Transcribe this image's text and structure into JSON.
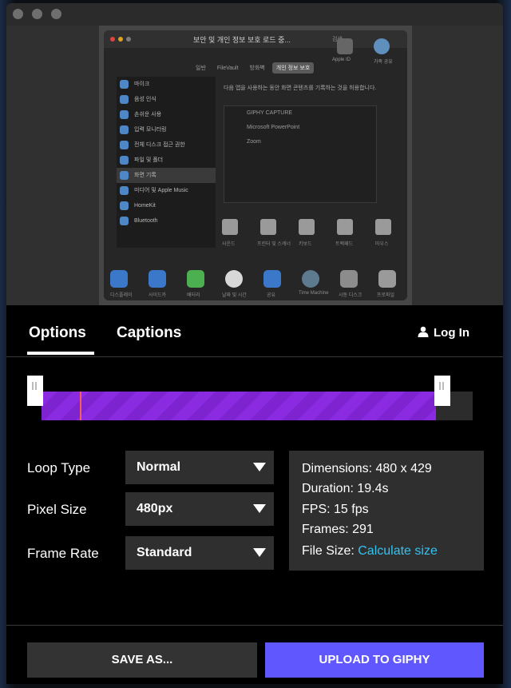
{
  "preview": {
    "window_title": "보안 및 개인 정보 보호 로드 중...",
    "search_placeholder": "검색",
    "tabs": [
      "일반",
      "FileVault",
      "방화벽",
      "개인 정보 보호"
    ],
    "active_tab": "개인 정보 보호",
    "list": [
      "마이크",
      "음성 인식",
      "손쉬운 사용",
      "입력 모니터링",
      "전체 디스크 접근 권한",
      "파일 및 폴더",
      "화면 기록",
      "미디어 및 Apple Music",
      "HomeKit",
      "Bluetooth"
    ],
    "selected_item": "화면 기록",
    "description": "다음 앱을 사용하는 동안 화면 콘텐츠를 기록하는 것을 허용합니다.",
    "apps": [
      "GIPHY CAPTURE",
      "Microsoft PowerPoint",
      "Zoom"
    ],
    "apple_id_label": "Apple ID",
    "family_label": "가족 공유",
    "bottom_icons": [
      "디스플레이",
      "사이드카",
      "배터리",
      "날짜 및 시간",
      "공유",
      "Time Machine",
      "시동 디스크",
      "프로파일"
    ],
    "grey_icons": [
      "사운드",
      "프린터 및 스캐너",
      "키보드",
      "트랙패드",
      "마우스"
    ]
  },
  "tabs": {
    "options": "Options",
    "captions": "Captions",
    "active": "Options"
  },
  "login": "Log In",
  "clip": {
    "start": 0.0,
    "end": 0.915,
    "playhead": 0.09
  },
  "settings": {
    "loop_type_label": "Loop Type",
    "loop_type": "Normal",
    "pixel_size_label": "Pixel Size",
    "pixel_size": "480px",
    "frame_rate_label": "Frame Rate",
    "frame_rate": "Standard"
  },
  "info": {
    "dimensions": "Dimensions: 480 x 429",
    "duration": "Duration: 19.4s",
    "fps": "FPS: 15 fps",
    "frames": "Frames: 291",
    "file_size_label": "File Size:",
    "calculate": "Calculate size"
  },
  "buttons": {
    "save": "SAVE AS...",
    "upload": "UPLOAD TO GIPHY"
  },
  "colors": {
    "accent": "#6157ff",
    "clip": "#8a2be2",
    "link": "#33c3f0",
    "playhead": "#ff5c5c"
  }
}
